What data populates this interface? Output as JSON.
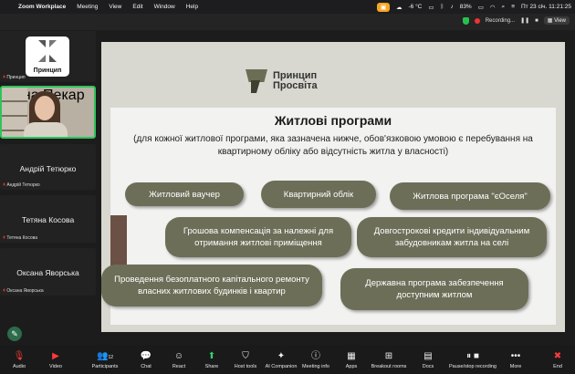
{
  "menubar": {
    "app_name": "Zoom Workplace",
    "items": [
      "Meeting",
      "View",
      "Edit",
      "Window",
      "Help"
    ],
    "temperature": "-6 °C",
    "battery": "83%",
    "datetime": "Пт 23 січ. 11:21:25"
  },
  "zoom_header": {
    "recording_label": "Recording...",
    "view_label": "View"
  },
  "participants": [
    {
      "name": "Принцип",
      "logo_text": "Принцип"
    },
    {
      "name": "Ілона Пекар"
    },
    {
      "name": "Андрій Тетюрко",
      "small_name": "Андрій Тетюрко"
    },
    {
      "name": "Тетяна Косова",
      "small_name": "Тетяна Косова"
    },
    {
      "name": "Оксана Яворська",
      "small_name": "Оксана Яворська"
    }
  ],
  "slide": {
    "logo_line1": "Принцип",
    "logo_line2": "Просвіта",
    "title": "Житлові програми",
    "subtitle": "(для кожної житлової програми, яка зазначена нижче, обов'язковою умовою є перебування на квартирному обліку або відсутність житла у власності)",
    "pills": [
      "Житловий ваучер",
      "Квартирний облік",
      "Житлова програма \"єОселя\"",
      "Грошова компенсація за належні для отримання житлові приміщення",
      "Довгострокові кредити індивідуальним забудовникам житла на селі",
      "Проведення безоплатного капітального ремонту власних житлових будинків і квартир",
      "Державна програма забезпечення доступним житлом"
    ]
  },
  "toolbar": {
    "items": [
      "Audio",
      "Video",
      "Participants",
      "Chat",
      "React",
      "Share",
      "Host tools",
      "AI Companion",
      "Meeting info",
      "Apps",
      "Breakout rooms",
      "Docs",
      "Pause/stop recording",
      "More",
      "End"
    ],
    "participants_count": "12"
  },
  "colors": {
    "pill": "#6d6e58",
    "slide_bg": "#d8d8d0",
    "panel_bg": "#f2f2f0",
    "active_speaker": "#2fc45a",
    "end_red": "#ff3b3b"
  }
}
